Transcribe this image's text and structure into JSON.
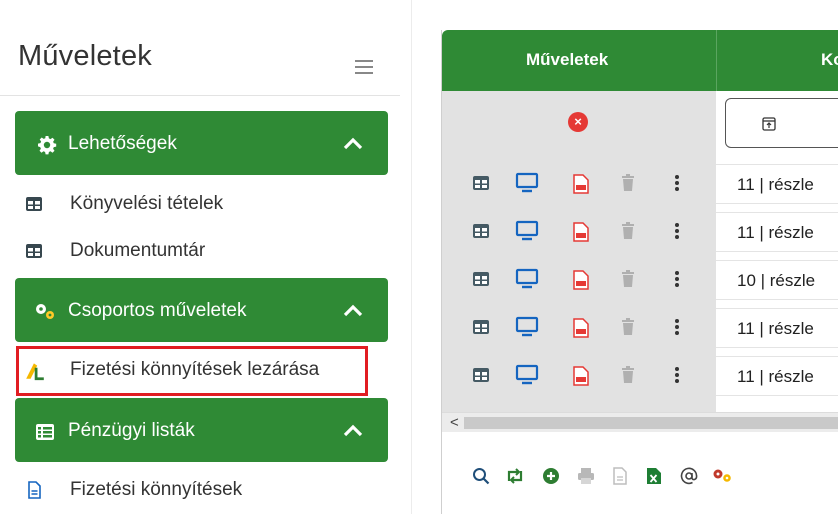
{
  "sidebar": {
    "title": "Műveletek",
    "menu_icon": "hamburger-icon",
    "groups": [
      {
        "label": "Lehetőségek",
        "icon": "cog-icon"
      },
      {
        "label": "Csoportos műveletek",
        "icon": "cogs-icon"
      },
      {
        "label": "Pénzügyi listák",
        "icon": "list-icon"
      }
    ],
    "items": [
      {
        "label": "Könyvelési tételek",
        "icon": "table-icon"
      },
      {
        "label": "Dokumentumtár",
        "icon": "table-icon"
      },
      {
        "label": "Fizetési könnyítések lezárása",
        "icon": "lock-close-icon"
      },
      {
        "label": "Fizetési könnyítések",
        "icon": "document-icon"
      }
    ]
  },
  "grid": {
    "header_actions": "Műveletek",
    "header_second": "Ko",
    "rows": [
      {
        "value": "11 | részle"
      },
      {
        "value": "11 | részle"
      },
      {
        "value": "10 | részle"
      },
      {
        "value": "11 | részle"
      },
      {
        "value": "11 | részle"
      }
    ],
    "scroll_left": "<"
  },
  "colors": {
    "accent": "#2f8a35",
    "highlight": "#e11d22",
    "monitor_icon": "#1565c0",
    "pdf_icon": "#e53935"
  }
}
